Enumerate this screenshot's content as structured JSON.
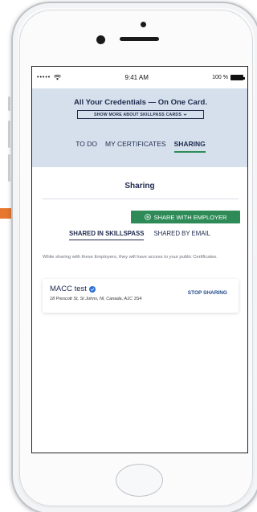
{
  "status_bar": {
    "signal": "•••••",
    "time": "9:41 AM",
    "battery": "100 %"
  },
  "banner": {
    "title": "All Your Credentials — On One Card.",
    "show_more": "SHOW MORE ABOUT SKILLPASS CARDS"
  },
  "tabs": [
    {
      "label": "TO DO",
      "active": false
    },
    {
      "label": "MY CERTIFICATES",
      "active": false
    },
    {
      "label": "SHARING",
      "active": true
    }
  ],
  "page": {
    "title": "Sharing"
  },
  "share_button": {
    "label": "SHARE WITH EMPLOYER"
  },
  "subtabs": [
    {
      "label": "SHARED IN SKILLSPASS",
      "active": true
    },
    {
      "label": "SHARED BY EMAIL",
      "active": false
    }
  ],
  "info_text": "While sharing with these Employers, they will have access to your public Certificates.",
  "employers": [
    {
      "name": "MACC test",
      "address": "18 Prescott St, St Johns, Nl, Canada, A1C 3S4",
      "action": "STOP SHARING"
    }
  ],
  "colors": {
    "accent": "#2e8b57",
    "banner_bg": "#d6e0ed",
    "navy": "#1f2a4d",
    "arrow": "#e8772e"
  }
}
